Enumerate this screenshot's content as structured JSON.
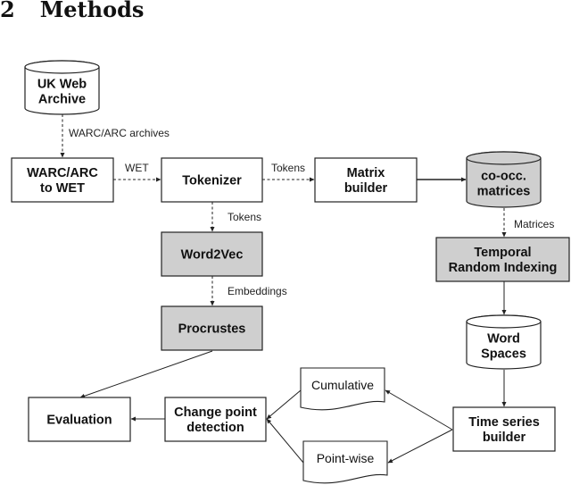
{
  "section": {
    "number": "2",
    "title": "Methods"
  },
  "colors": {
    "stroke": "#222222",
    "shaded_fill": "#cfcfcf",
    "plain_fill": "#ffffff"
  },
  "nodes": {
    "uk_web_archive": {
      "lines": [
        "UK Web",
        "Archive"
      ],
      "shape": "cylinder",
      "shaded": false
    },
    "warc_to_wet": {
      "lines": [
        "WARC/ARC",
        "to WET"
      ],
      "shape": "box",
      "shaded": false
    },
    "tokenizer": {
      "lines": [
        "Tokenizer"
      ],
      "shape": "box",
      "shaded": false
    },
    "matrix_builder": {
      "lines": [
        "Matrix",
        "builder"
      ],
      "shape": "box",
      "shaded": false
    },
    "co_occ_matrices": {
      "lines": [
        "co-occ.",
        "matrices"
      ],
      "shape": "cylinder",
      "shaded": true
    },
    "temporal_random_indexing": {
      "lines": [
        "Temporal",
        "Random Indexing"
      ],
      "shape": "box",
      "shaded": true
    },
    "word2vec": {
      "lines": [
        "Word2Vec"
      ],
      "shape": "box",
      "shaded": true
    },
    "procrustes": {
      "lines": [
        "Procrustes"
      ],
      "shape": "box",
      "shaded": true
    },
    "word_spaces": {
      "lines": [
        "Word",
        "Spaces"
      ],
      "shape": "cylinder",
      "shaded": false
    },
    "time_series_builder": {
      "lines": [
        "Time series",
        "builder"
      ],
      "shape": "box",
      "shaded": false
    },
    "cumulative": {
      "lines": [
        "Cumulative"
      ],
      "shape": "document",
      "shaded": false
    },
    "point_wise": {
      "lines": [
        "Point-wise"
      ],
      "shape": "document",
      "shaded": false
    },
    "change_point_detection": {
      "lines": [
        "Change point",
        "detection"
      ],
      "shape": "box",
      "shaded": false
    },
    "evaluation": {
      "lines": [
        "Evaluation"
      ],
      "shape": "box",
      "shaded": false
    }
  },
  "edges": [
    {
      "from": "uk_web_archive",
      "to": "warc_to_wet",
      "label": "WARC/ARC archives",
      "style": "dashed"
    },
    {
      "from": "warc_to_wet",
      "to": "tokenizer",
      "label": "WET",
      "style": "dashed"
    },
    {
      "from": "tokenizer",
      "to": "matrix_builder",
      "label": "Tokens",
      "style": "dashed"
    },
    {
      "from": "matrix_builder",
      "to": "co_occ_matrices",
      "label": "",
      "style": "solid"
    },
    {
      "from": "co_occ_matrices",
      "to": "temporal_random_indexing",
      "label": "Matrices",
      "style": "dashed"
    },
    {
      "from": "tokenizer",
      "to": "word2vec",
      "label": "Tokens",
      "style": "dashed"
    },
    {
      "from": "word2vec",
      "to": "procrustes",
      "label": "Embeddings",
      "style": "dashed"
    },
    {
      "from": "procrustes",
      "to": "evaluation",
      "label": "",
      "style": "solid"
    },
    {
      "from": "temporal_random_indexing",
      "to": "word_spaces",
      "label": "",
      "style": "solid"
    },
    {
      "from": "word_spaces",
      "to": "time_series_builder",
      "label": "",
      "style": "solid"
    },
    {
      "from": "time_series_builder",
      "to": "cumulative",
      "label": "",
      "style": "solid"
    },
    {
      "from": "time_series_builder",
      "to": "point_wise",
      "label": "",
      "style": "solid"
    },
    {
      "from": "cumulative",
      "to": "change_point_detection",
      "label": "",
      "style": "solid"
    },
    {
      "from": "point_wise",
      "to": "change_point_detection",
      "label": "",
      "style": "solid"
    },
    {
      "from": "change_point_detection",
      "to": "evaluation",
      "label": "",
      "style": "solid"
    }
  ]
}
